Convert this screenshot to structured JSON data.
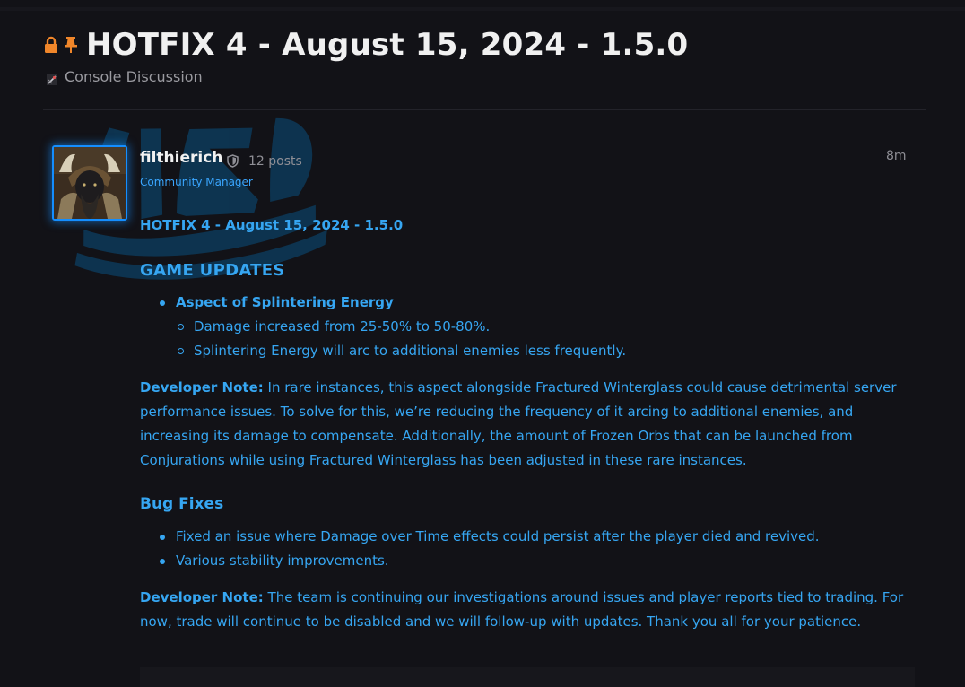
{
  "topic": {
    "title": "HOTFIX 4 - August 15, 2024 - 1.5.0",
    "category": "Console Discussion",
    "icons": {
      "lock": "lock-icon",
      "pin": "pin-icon",
      "category": "category-icon"
    },
    "accent_color": "#f0862a"
  },
  "post": {
    "author": {
      "username": "filthierich",
      "post_count": "12 posts",
      "title": "Community Manager",
      "badge_icon": "shield-icon",
      "avatar_border_color": "#148eff"
    },
    "timestamp": "8m",
    "content": {
      "headline": "HOTFIX 4 - August 15, 2024 - 1.5.0",
      "game_updates_heading": "GAME UPDATES",
      "aspect": {
        "name": "Aspect of Splintering Energy",
        "changes": [
          "Damage increased from 25-50% to 50-80%.",
          "Splintering Energy will arc to additional enemies less frequently."
        ]
      },
      "dev_note_1": {
        "label": "Developer Note:",
        "text": " In rare instances, this aspect alongside Fractured Winterglass could cause detrimental server performance issues. To solve for this, we’re reducing the frequency of it arcing to additional enemies, and increasing its damage to compensate. Additionally, the amount of Frozen Orbs that can be launched from Conjurations while using Fractured Winterglass has been adjusted in these rare instances."
      },
      "bug_fixes_heading": "Bug Fixes",
      "bug_fixes": [
        "Fixed an issue where Damage over Time effects could persist after the player died and revived.",
        "Various stability improvements."
      ],
      "dev_note_2": {
        "label": "Developer Note:",
        "text": " The team is continuing our investigations around issues and player reports tied to trading. For now, trade will continue to be disabled and we will follow-up with updates. Thank you all for your patience."
      },
      "text_color": "#36a6f2"
    }
  }
}
